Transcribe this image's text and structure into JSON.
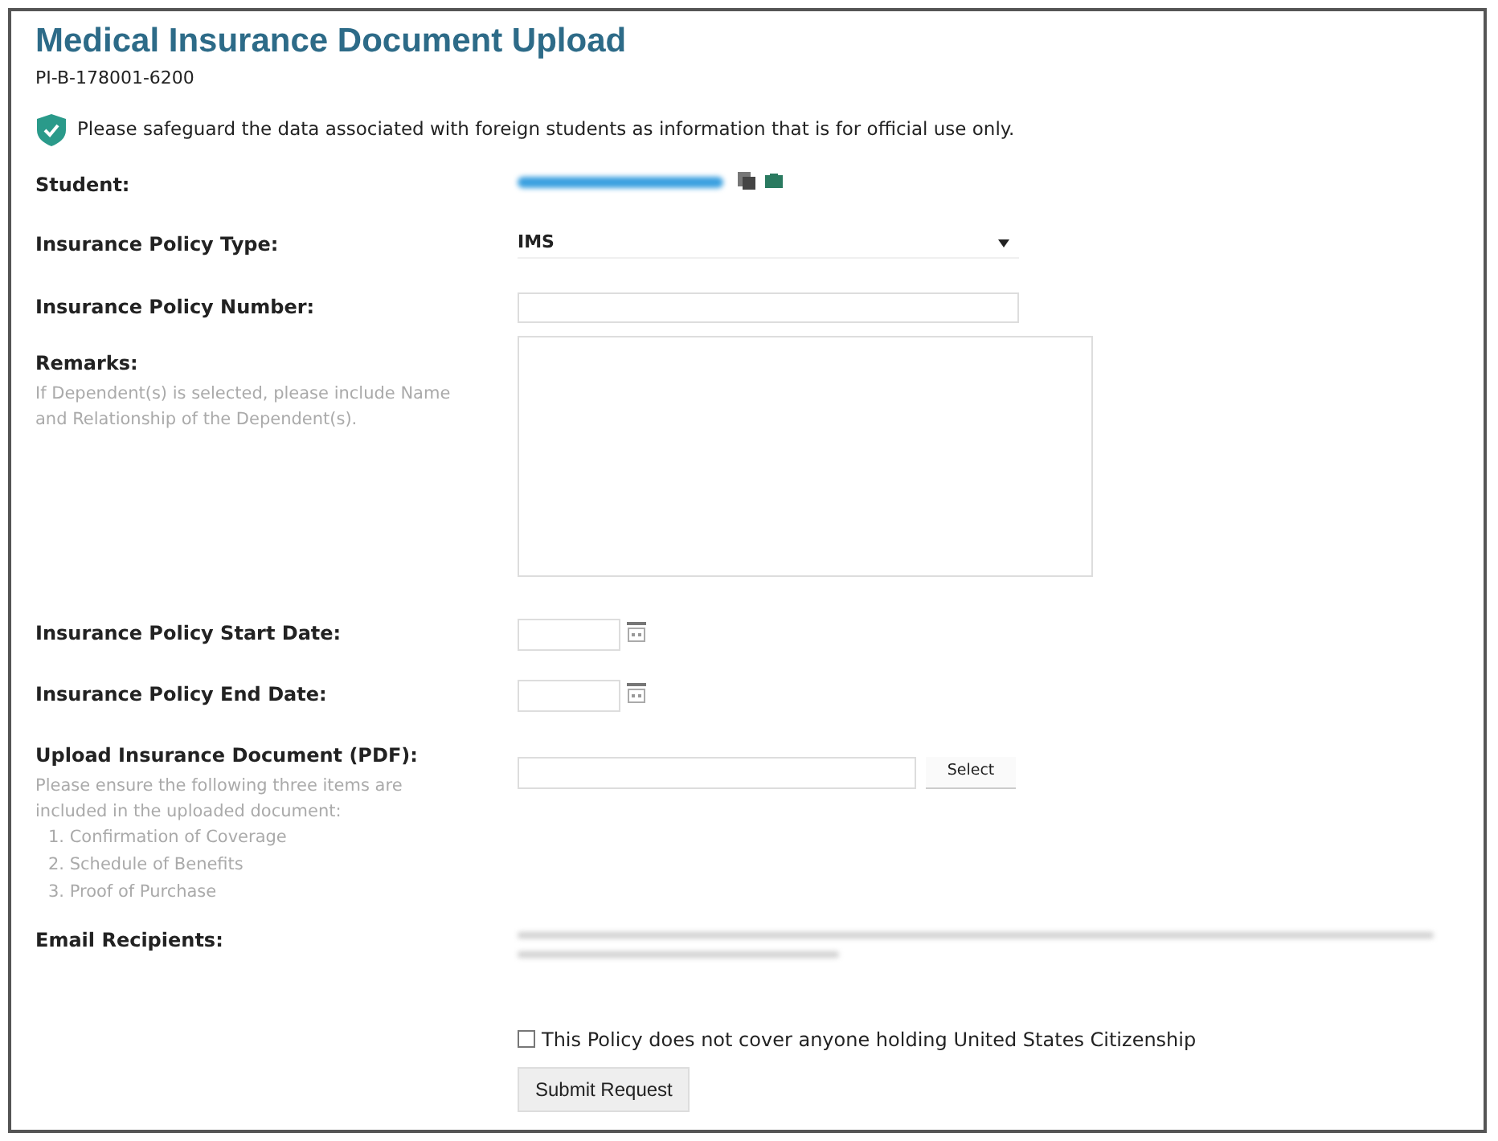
{
  "title": "Medical Insurance Document Upload",
  "record_id": "PI-B-178001-6200",
  "notice": "Please safeguard the data associated with foreign students as information that is for official use only.",
  "fields": [
    {
      "kind": "student",
      "label": "Student:"
    },
    {
      "kind": "select",
      "label": "Insurance Policy Type:",
      "value": "IMS"
    },
    {
      "kind": "text",
      "label": "Insurance Policy Number:"
    },
    {
      "kind": "textarea",
      "label": "Remarks:",
      "hint": "If Dependent(s) is selected, please include Name and Relationship of the Dependent(s)."
    },
    {
      "kind": "date",
      "label": "Insurance Policy Start Date:"
    },
    {
      "kind": "date",
      "label": "Insurance Policy End Date:"
    },
    {
      "kind": "file",
      "label": "Upload Insurance Document (PDF):",
      "hint": "Please ensure the following three items are included in the uploaded document:",
      "hint_items": [
        "1. Confirmation of Coverage",
        "2. Schedule of Benefits",
        "3. Proof of Purchase"
      ],
      "button": "Select"
    },
    {
      "kind": "email",
      "label": "Email Recipients:"
    }
  ],
  "citizenship_checkbox": {
    "label": "This Policy does not cover anyone holding United States Citizenship",
    "checked": false
  },
  "submit": "Submit Request"
}
